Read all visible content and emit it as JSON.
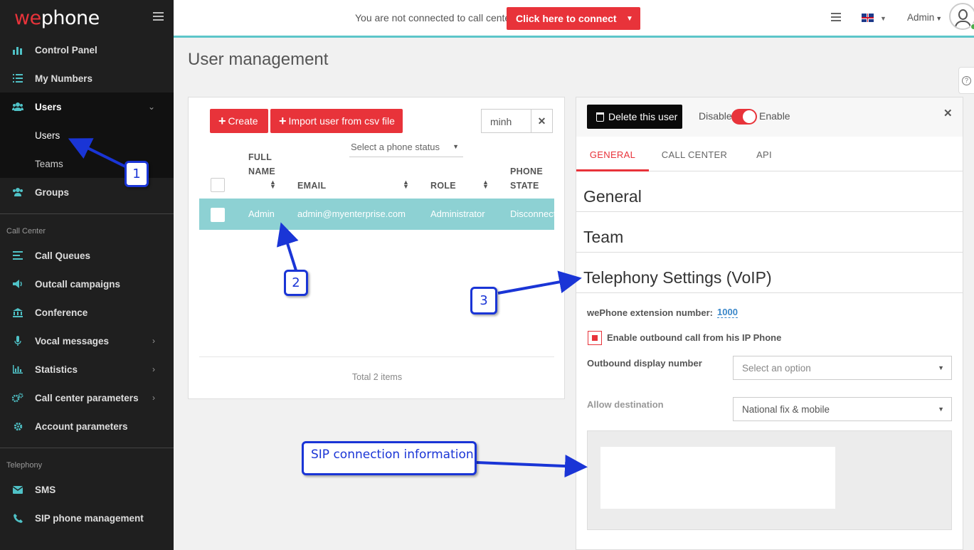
{
  "app": {
    "logo_we": "we",
    "logo_phone": "phone"
  },
  "sidebar": {
    "items": [
      {
        "label": "Control Panel",
        "icon": "bar-chart-icon"
      },
      {
        "label": "My Numbers",
        "icon": "list-icon"
      },
      {
        "label": "Users",
        "icon": "users-icon"
      }
    ],
    "users_sub": [
      {
        "label": "Users"
      },
      {
        "label": "Teams"
      }
    ],
    "groups": {
      "label": "Groups",
      "icon": "groups-icon"
    },
    "section_call_center": "Call Center",
    "call_center_items": [
      {
        "label": "Call Queues",
        "icon": "queue-icon"
      },
      {
        "label": "Outcall campaigns",
        "icon": "megaphone-icon"
      },
      {
        "label": "Conference",
        "icon": "bank-icon"
      },
      {
        "label": "Vocal messages",
        "icon": "microphone-icon"
      },
      {
        "label": "Statistics",
        "icon": "stats-icon"
      },
      {
        "label": "Call center parameters",
        "icon": "cogs-icon"
      },
      {
        "label": "Account parameters",
        "icon": "gear-icon"
      }
    ],
    "section_telephony": "Telephony",
    "telephony_items": [
      {
        "label": "SMS",
        "icon": "envelope-icon"
      },
      {
        "label": "SIP phone management",
        "icon": "phone-icon"
      }
    ]
  },
  "topbar": {
    "status_text": "You are not connected to call center",
    "connect_label": "Click here to connect",
    "user_label": "Admin"
  },
  "page": {
    "title": "User management"
  },
  "users_panel": {
    "create_label": "Create",
    "import_label": "Import user from csv file",
    "search_value": "minh",
    "phone_status_placeholder": "Select a phone status",
    "columns": {
      "fullname_1": "FULL",
      "fullname_2": "NAME",
      "email": "EMAIL",
      "role": "ROLE",
      "phone_1": "PHONE",
      "phone_2": "STATE"
    },
    "rows": [
      {
        "name": "Admin",
        "email": "admin@myenterprise.com",
        "role": "Administrator",
        "phone_state": "Disconnected"
      }
    ],
    "total": "Total 2 items"
  },
  "user_detail": {
    "delete_label": "Delete this user",
    "disable_label": "Disable",
    "enable_label": "Enable",
    "enabled": true,
    "tabs": [
      "GENERAL",
      "CALL CENTER",
      "API"
    ],
    "sections": [
      "General",
      "Team",
      "Telephony Settings (VoIP)"
    ],
    "extension_label": "wePhone extension number:",
    "extension_value": "1000",
    "outbound_ip_label": "Enable outbound call from his IP Phone",
    "outbound_display_label": "Outbound display number",
    "outbound_display_placeholder": "Select an option",
    "allow_destination_label": "Allow destination",
    "allow_destination_value": "National fix & mobile"
  },
  "annotations": {
    "a1": "1",
    "a2": "2",
    "a3": "3",
    "sip": "SIP connection information"
  },
  "colors": {
    "accent": "#e8333a",
    "teal": "#5dc6c9",
    "selected_row": "#8dd1d3",
    "annotation": "#1a35d6"
  }
}
